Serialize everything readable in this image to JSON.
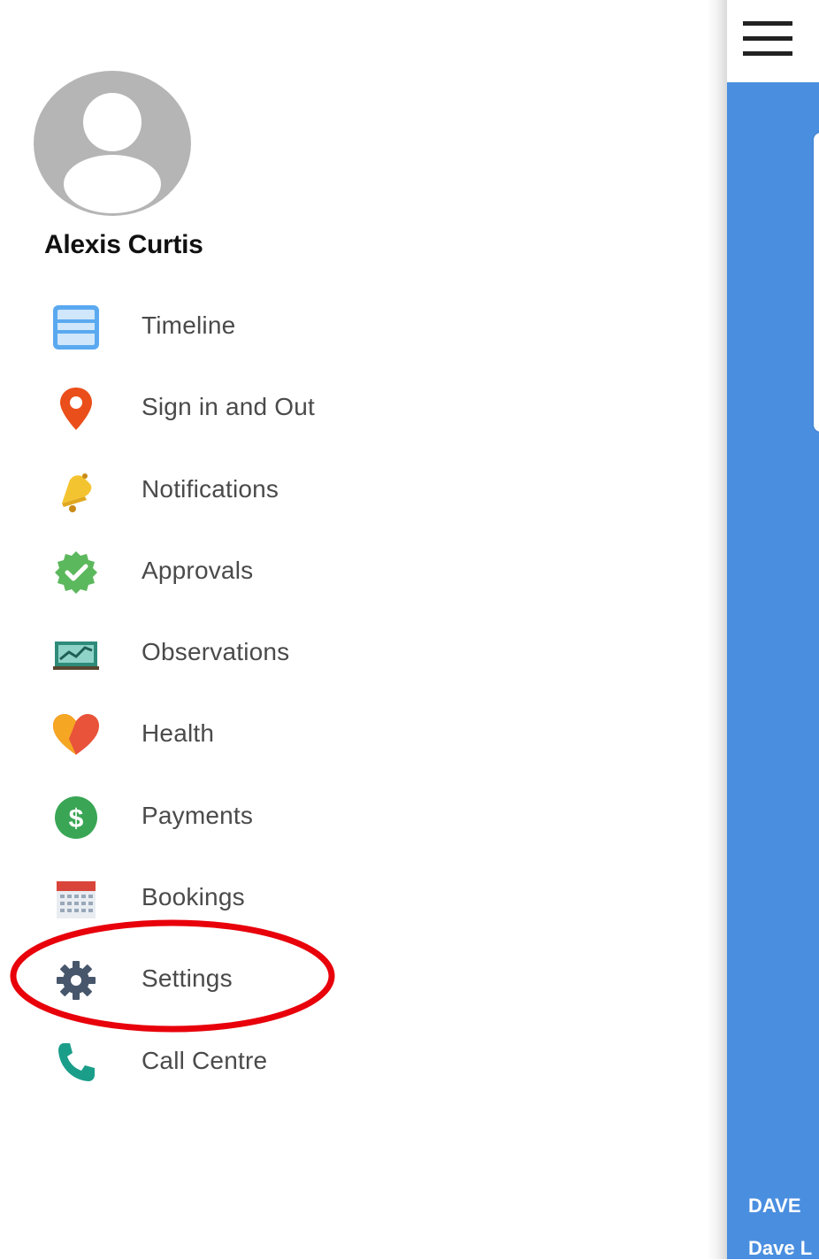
{
  "drawer": {
    "user_name": "Alexis Curtis",
    "items": [
      {
        "label": "Timeline",
        "icon": "timeline-icon",
        "color": "#5aa9f0"
      },
      {
        "label": "Sign in and Out",
        "icon": "location-pin-icon",
        "color": "#ea4e1b"
      },
      {
        "label": "Notifications",
        "icon": "bell-icon",
        "color": "#f4c430"
      },
      {
        "label": "Approvals",
        "icon": "verified-check-icon",
        "color": "#5cb85c"
      },
      {
        "label": "Observations",
        "icon": "chart-board-icon",
        "color": "#2e8b7a"
      },
      {
        "label": "Health",
        "icon": "heart-icon",
        "color": "#e8533a"
      },
      {
        "label": "Payments",
        "icon": "dollar-icon",
        "color": "#3aa655"
      },
      {
        "label": "Bookings",
        "icon": "calendar-icon",
        "color": "#d9453b"
      },
      {
        "label": "Settings",
        "icon": "gear-icon",
        "color": "#47566b"
      },
      {
        "label": "Call Centre",
        "icon": "phone-icon",
        "color": "#1a9e8a"
      }
    ],
    "highlight_color": "#e8000b"
  },
  "app": {
    "menu_icon": "hamburger-menu-icon",
    "background_color": "#4a8ee0",
    "footer_line1": "DAVE",
    "footer_line2": "Dave L"
  }
}
